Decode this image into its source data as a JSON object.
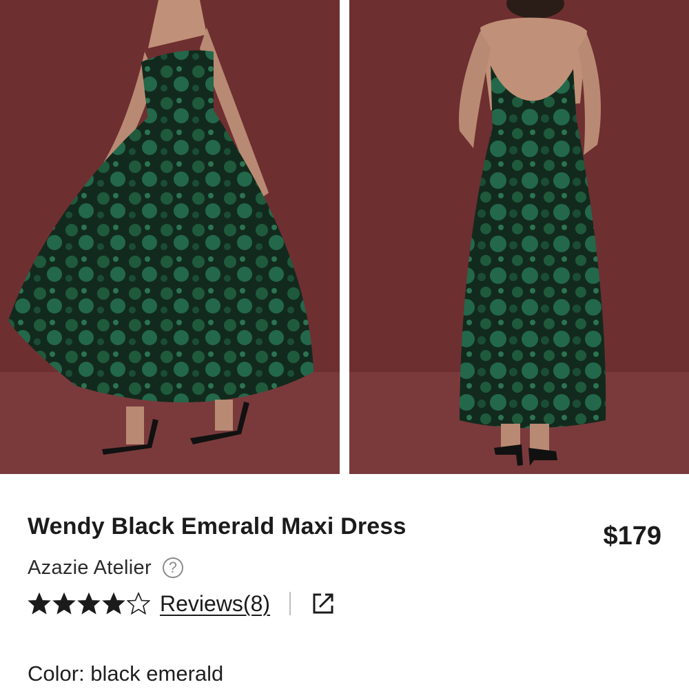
{
  "gallery": {
    "images": [
      {
        "name": "front-view"
      },
      {
        "name": "back-view"
      }
    ],
    "colors": {
      "backdrop": "#6e2f31",
      "floor": "#7a3a3c",
      "dress_dark": "#0f2419",
      "dress_green": "#1f5a3c"
    }
  },
  "product": {
    "title": "Wendy Black Emerald Maxi Dress",
    "price": "$179",
    "brand": "Azazie Atelier",
    "help_icon": "question-mark-circle-icon",
    "rating": 4,
    "rating_max": 5,
    "reviews_label": "Reviews(8)",
    "share_icon": "external-link-icon",
    "color_label": "Color: black emerald"
  }
}
